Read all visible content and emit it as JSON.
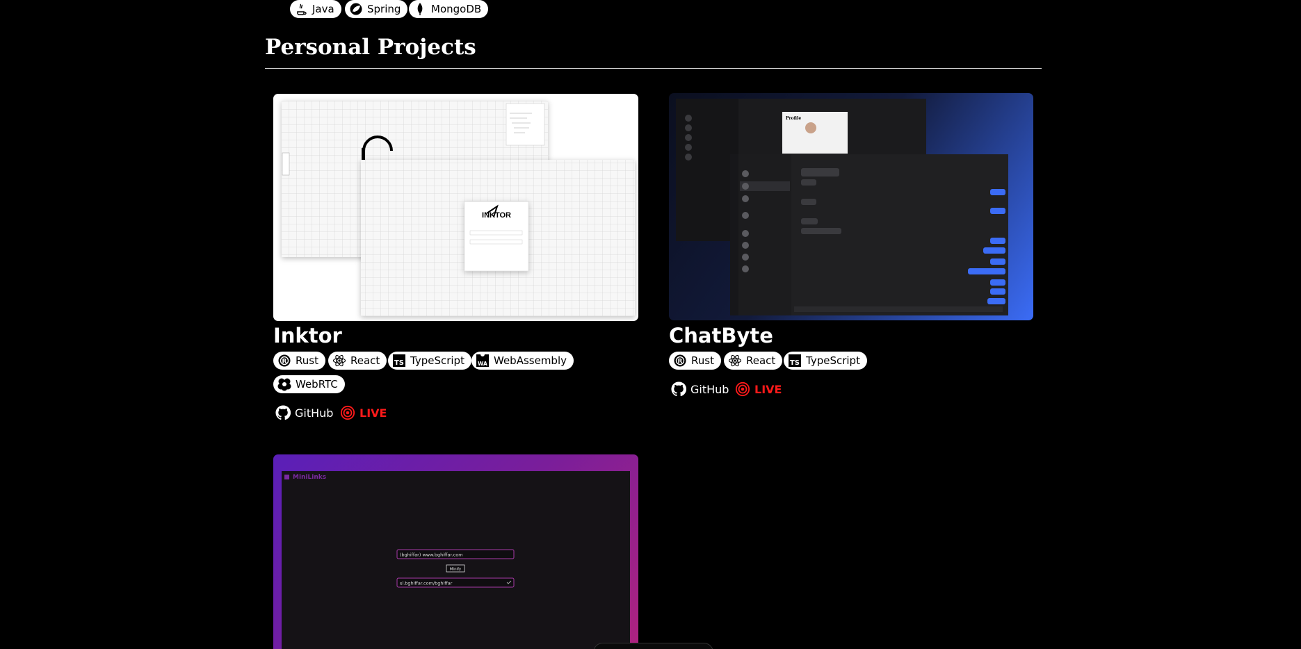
{
  "top_tags": [
    {
      "label": "Java",
      "icon": "java-icon"
    },
    {
      "label": "Spring",
      "icon": "spring-icon"
    },
    {
      "label": "MongoDB",
      "icon": "mongodb-icon"
    }
  ],
  "section": {
    "title": "Personal Projects"
  },
  "projects": [
    {
      "title": "Inktor",
      "tags": [
        {
          "label": "Rust",
          "icon": "rust-icon"
        },
        {
          "label": "React",
          "icon": "react-icon"
        },
        {
          "label": "TypeScript",
          "icon": "typescript-icon"
        },
        {
          "label": "WebAssembly",
          "icon": "webassembly-icon"
        },
        {
          "label": "WebRTC",
          "icon": "webrtc-icon"
        }
      ],
      "github_label": "GitHub",
      "live_label": "LIVE",
      "screenshot": {
        "logo_text": "INKTOR"
      }
    },
    {
      "title": "ChatByte",
      "tags": [
        {
          "label": "Rust",
          "icon": "rust-icon"
        },
        {
          "label": "React",
          "icon": "react-icon"
        },
        {
          "label": "TypeScript",
          "icon": "typescript-icon"
        }
      ],
      "github_label": "GitHub",
      "live_label": "LIVE",
      "screenshot": {
        "profile_title": "Profile"
      }
    },
    {
      "screenshot": {
        "app_name": "MiniLinks",
        "input_value": "(bghiffar) www.bghiffar.com",
        "button_label": "Minify",
        "output_value": "sl.bghiffar.com/bghiffar"
      }
    }
  ],
  "colors": {
    "background": "#000000",
    "tag_bg": "#ffffff",
    "live": "#ff1a1a",
    "chat_accent": "#3b6cf6",
    "minilinks_accent": "#b0237f"
  }
}
